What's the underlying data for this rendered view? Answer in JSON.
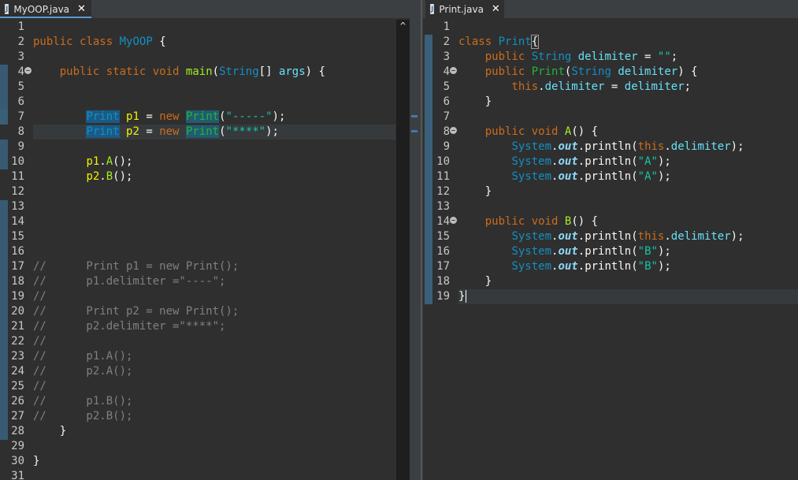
{
  "left_tab": {
    "name": "MyOOP.java",
    "icon": "J",
    "close": "✕"
  },
  "right_tab": {
    "name": "Print.java",
    "icon": "J",
    "close": "✕"
  },
  "left_line_numbers": [
    "1",
    "2",
    "3",
    "4",
    "5",
    "6",
    "7",
    "8",
    "9",
    "10",
    "11",
    "12",
    "13",
    "14",
    "15",
    "16",
    "17",
    "18",
    "19",
    "20",
    "21",
    "22",
    "23",
    "24",
    "25",
    "26",
    "27",
    "28",
    "29",
    "30",
    "31"
  ],
  "right_line_numbers": [
    "1",
    "2",
    "3",
    "4",
    "5",
    "6",
    "7",
    "8",
    "9",
    "10",
    "11",
    "12",
    "13",
    "14",
    "15",
    "16",
    "17",
    "18",
    "19"
  ],
  "scroll_up_glyph": "^",
  "left_code": {
    "l2": {
      "k1": "public",
      "k2": "class",
      "name": "MyOOP",
      "brace": "{"
    },
    "l4": {
      "k1": "public",
      "k2": "static",
      "k3": "void",
      "method": "main",
      "p1": "(",
      "type": "String",
      "arr": "[]",
      "arg": "args",
      "p2": ")",
      "brace": "{"
    },
    "l7": {
      "type": "Print",
      "var": "p1",
      "eq": "=",
      "kw": "new",
      "cls": "Print",
      "p1": "(",
      "str": "\"-----\"",
      "p2": ");"
    },
    "l8": {
      "type": "Print",
      "var": "p2",
      "eq": "=",
      "kw": "new",
      "cls": "Print",
      "p1": "(",
      "str": "\"****\"",
      "p2": ");"
    },
    "l10": {
      "var": "p1",
      "dot": ".",
      "method": "A",
      "rest": "();"
    },
    "l11": {
      "var": "p2",
      "dot": ".",
      "method": "B",
      "rest": "();"
    },
    "comments": {
      "l17": "//      Print p1 = new Print();",
      "l18": "//      p1.delimiter =\"----\";",
      "l19": "//",
      "l20": "//      Print p2 = new Print();",
      "l21": "//      p2.delimiter =\"****\";",
      "l22": "//",
      "l23": "//      p1.A();",
      "l24": "//      p2.A();",
      "l25": "//",
      "l26": "//      p1.B();",
      "l27": "//      p2.B();"
    },
    "l28": "}",
    "l30": "}"
  },
  "right_code": {
    "l2": {
      "kw": "class",
      "name": "Print",
      "brace": "{"
    },
    "l3": {
      "k1": "public",
      "type": "String",
      "field": "delimiter",
      "eq": "=",
      "str": "\"\"",
      "semi": ";"
    },
    "l4": {
      "k1": "public",
      "name": "Print",
      "p1": "(",
      "type": "String",
      "param": "delimiter",
      "p2": ")",
      "brace": "{"
    },
    "l5": {
      "kw": "this",
      "dot": ".",
      "field": "delimiter",
      "eq": "=",
      "param": "delimiter",
      "semi": ";"
    },
    "l6": "}",
    "l8": {
      "k1": "public",
      "k2": "void",
      "method": "A",
      "rest": "()",
      "brace": "{"
    },
    "l9": {
      "sys": "System",
      "dot1": ".",
      "out": "out",
      "dot2": ".",
      "call": "println",
      "p1": "(",
      "kw": "this",
      "dot3": ".",
      "field": "delimiter",
      "p2": ");"
    },
    "l10": {
      "sys": "System",
      "dot1": ".",
      "out": "out",
      "dot2": ".",
      "call": "println",
      "p1": "(",
      "str": "\"A\"",
      "p2": ");"
    },
    "l11": {
      "sys": "System",
      "dot1": ".",
      "out": "out",
      "dot2": ".",
      "call": "println",
      "p1": "(",
      "str": "\"A\"",
      "p2": ");"
    },
    "l12": "}",
    "l14": {
      "k1": "public",
      "k2": "void",
      "method": "B",
      "rest": "()",
      "brace": "{"
    },
    "l15": {
      "sys": "System",
      "dot1": ".",
      "out": "out",
      "dot2": ".",
      "call": "println",
      "p1": "(",
      "kw": "this",
      "dot3": ".",
      "field": "delimiter",
      "p2": ");"
    },
    "l16": {
      "sys": "System",
      "dot1": ".",
      "out": "out",
      "dot2": ".",
      "call": "println",
      "p1": "(",
      "str": "\"B\"",
      "p2": ");"
    },
    "l17": {
      "sys": "System",
      "dot1": ".",
      "out": "out",
      "dot2": ".",
      "call": "println",
      "p1": "(",
      "str": "\"B\"",
      "p2": ");"
    },
    "l18": "}",
    "l19": "}"
  },
  "colors": {
    "background": "#2f2f2f",
    "keyword": "#cc6c1d",
    "type": "#1290c3",
    "string": "#17c6a3",
    "comment": "#808080",
    "variable": "#f2f200",
    "method": "#a7ec21"
  }
}
